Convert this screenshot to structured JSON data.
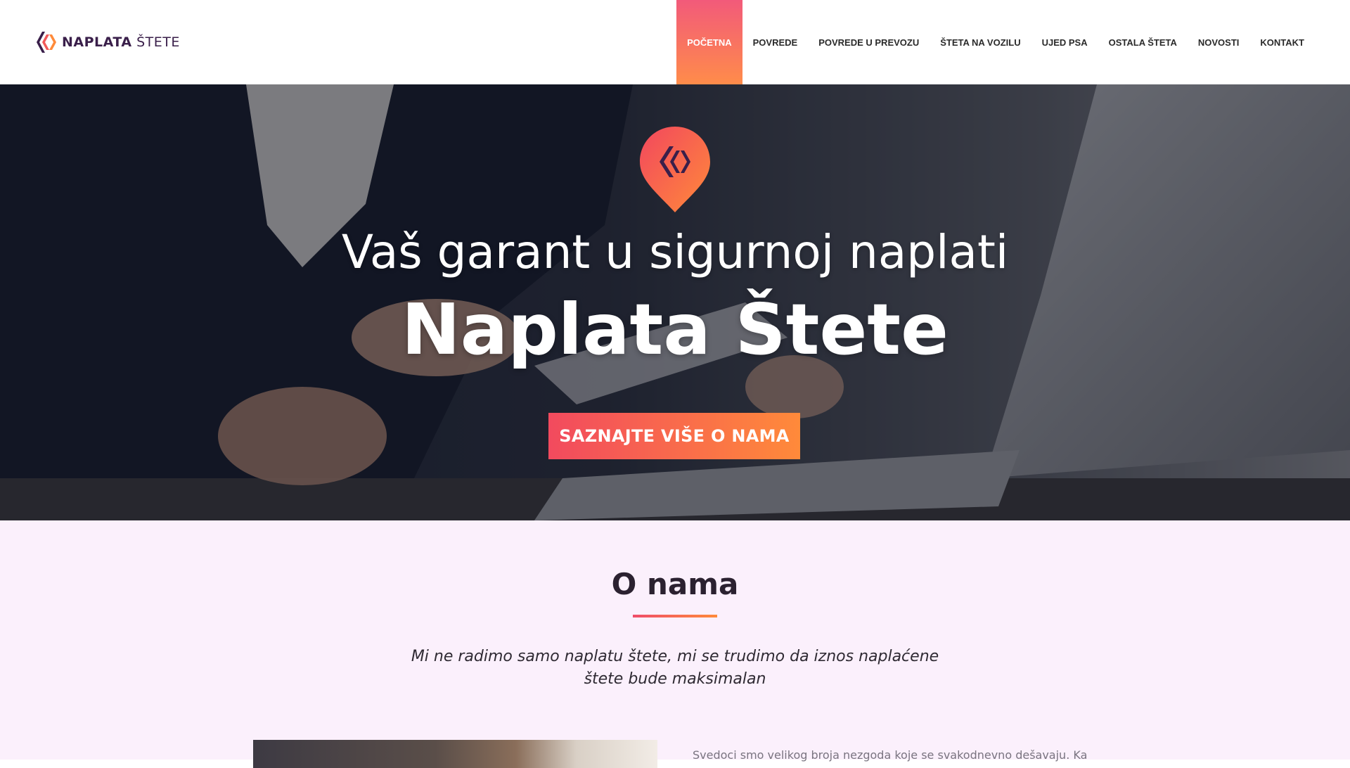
{
  "header": {
    "logo_bold": "NAPLATA",
    "logo_light": "ŠTETE",
    "nav": [
      {
        "label": "POČETNA",
        "active": true
      },
      {
        "label": "POVREDE",
        "active": false
      },
      {
        "label": "POVREDE U PREVOZU",
        "active": false
      },
      {
        "label": "ŠTETA NA VOZILU",
        "active": false
      },
      {
        "label": "UJED PSA",
        "active": false
      },
      {
        "label": "OSTALA ŠTETA",
        "active": false
      },
      {
        "label": "NOVOSTI",
        "active": false
      },
      {
        "label": "KONTAKT",
        "active": false
      }
    ]
  },
  "hero": {
    "subtitle": "Vaš garant u sigurnoj naplati",
    "title": "Naplata Štete",
    "cta": "SAZNAJTE VIŠE O NAMA"
  },
  "about": {
    "title": "O nama",
    "lead": "Mi ne radimo samo naplatu štete, mi se trudimo da iznos naplaćene štete bude maksimalan",
    "text": "Svedoci smo velikog broja nezgoda koje se svakodnevno dešavaju. Kako"
  },
  "colors": {
    "accent_start": "#f24a5e",
    "accent_end": "#ff8a3a",
    "brand_dark": "#3a1f4a",
    "about_bg": "#fbf0fc"
  }
}
